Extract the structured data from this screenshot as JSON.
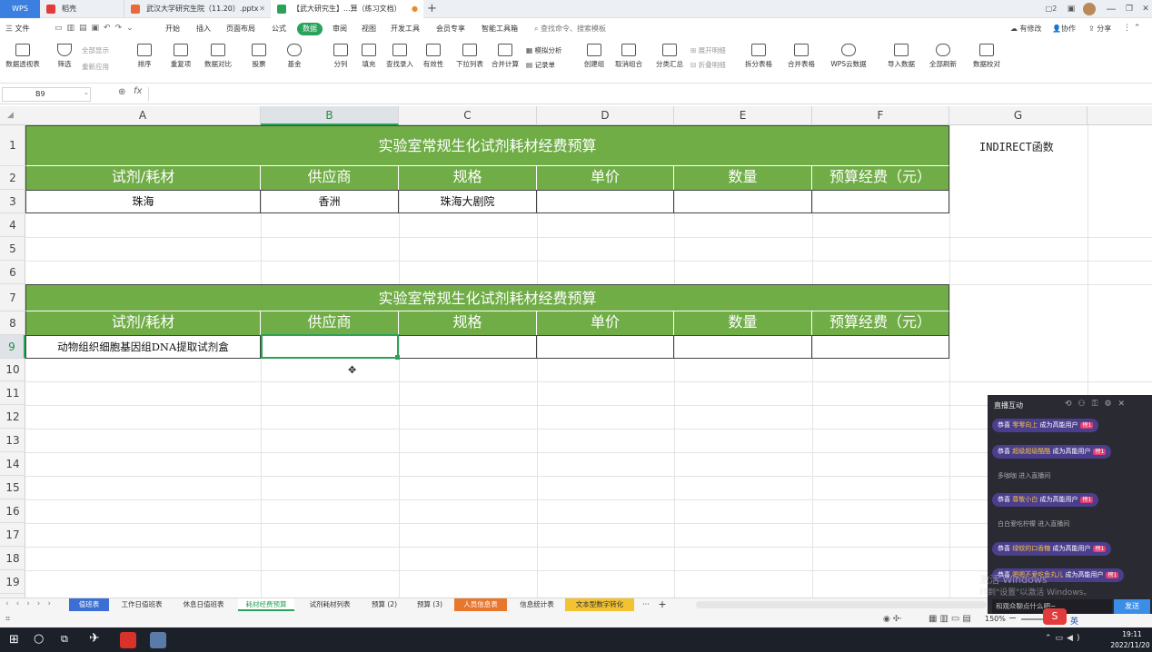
{
  "titlebar": {
    "app_logo": "WPS",
    "tabs": [
      {
        "label": "稻壳",
        "color": "#e33b3b"
      },
      {
        "label": "武汉大学研究生院（11.20）.pptx",
        "color": "#e8693a"
      },
      {
        "label": "【武大研究生】...算（练习文档）",
        "color": "#2aa259"
      }
    ],
    "new_tab": "+",
    "user_icons": [
      "□2",
      "▣",
      "👤"
    ],
    "window": [
      "—",
      "❐",
      "✕"
    ]
  },
  "menubar": {
    "file": "三 文件",
    "items": [
      "开始",
      "插入",
      "页面布局",
      "公式",
      "数据",
      "审阅",
      "视图",
      "开发工具",
      "会员专享",
      "智能工具箱"
    ],
    "active": "数据",
    "search": "查找命令、搜索模板",
    "right": [
      "有修改",
      "协作",
      "分享"
    ]
  },
  "toolbar": {
    "pivot": "数据透视表",
    "filter": "筛选",
    "show_all": "全部显示",
    "reapply": "重新应用",
    "sort": "排序",
    "dup": "重复项",
    "compare": "数据对比",
    "stock": "股票",
    "fund": "基金",
    "split": "分列",
    "fill": "填充",
    "lookup": "查找录入",
    "validity": "有效性",
    "dropdown": "下拉列表",
    "merge_calc": "合并计算",
    "simulate": "模拟分析",
    "record": "记录单",
    "create_group": "创建组",
    "ungroup": "取消组合",
    "subtotal": "分类汇总",
    "expand": "展开明细",
    "collapse": "折叠明细",
    "split_table": "拆分表格",
    "merge_table": "合并表格",
    "wps_cloud": "WPS云数据",
    "import": "导入数据",
    "refresh": "全部刷新",
    "verify": "数据校对"
  },
  "formula": {
    "cell_ref": "B9",
    "fx": "fx",
    "value": ""
  },
  "columns": [
    "A",
    "B",
    "C",
    "D",
    "E",
    "F",
    "G"
  ],
  "rows": [
    "1",
    "2",
    "3",
    "4",
    "5",
    "6",
    "7",
    "8",
    "9",
    "10",
    "11",
    "12",
    "13",
    "14",
    "15",
    "16",
    "17",
    "18",
    "19"
  ],
  "selected_column": "B",
  "selected_row": "9",
  "sheet": {
    "title": "实验室常规生化试剂耗材经费预算",
    "headers": [
      "试剂/耗材",
      "供应商",
      "规格",
      "单价",
      "数量",
      "预算经费（元）"
    ],
    "row3": [
      "珠海",
      "香洲",
      "珠海大剧院",
      "",
      "",
      ""
    ],
    "title2": "实验室常规生化试剂耗材经费预算",
    "headers2": [
      "试剂/耗材",
      "供应商",
      "规格",
      "单价",
      "数量",
      "预算经费（元）"
    ],
    "row9": [
      "动物组织细胞基因组DNA提取试剂盒",
      "",
      "",
      "",
      "",
      ""
    ],
    "g1": "INDIRECT函数"
  },
  "sheet_tabs": [
    {
      "label": "值班表",
      "bg": "#3b6fd4",
      "fg": "#ffffff"
    },
    {
      "label": "工作日值班表",
      "bg": "",
      "fg": "#333333"
    },
    {
      "label": "休息日值班表",
      "bg": "",
      "fg": "#333333"
    },
    {
      "label": "耗材经费预算",
      "bg": "#ffffff",
      "fg": "#2aa259"
    },
    {
      "label": "试剂耗材列表",
      "bg": "",
      "fg": "#333333"
    },
    {
      "label": "预算 (2)",
      "bg": "",
      "fg": "#333333"
    },
    {
      "label": "预算 (3)",
      "bg": "",
      "fg": "#333333"
    },
    {
      "label": "人员信息表",
      "bg": "#e8772e",
      "fg": "#ffffff"
    },
    {
      "label": "信息统计表",
      "bg": "",
      "fg": "#333333"
    },
    {
      "label": "文本型数字转化",
      "bg": "#f2c230",
      "fg": "#333333"
    }
  ],
  "sheet_more": "···",
  "sheet_add": "+",
  "status": {
    "zoom": "150%",
    "minus": "−",
    "plus": "+"
  },
  "live": {
    "title": "直播互动",
    "messages": [
      {
        "kind": "pill",
        "pre": "恭喜",
        "name": "零零向上",
        "post": "成为高能用户",
        "badge": "榜1"
      },
      {
        "kind": "pill",
        "pre": "恭喜",
        "name": "超级超级酷酷",
        "post": "成为高能用户",
        "badge": "榜1"
      },
      {
        "kind": "plain",
        "pre": "",
        "name": "多咖咖",
        "post": "进入直播间",
        "badge": ""
      },
      {
        "kind": "pill",
        "pre": "恭喜",
        "name": "尊敬小白",
        "post": "成为高能用户",
        "badge": "榜1"
      },
      {
        "kind": "plain",
        "pre": "",
        "name": "白白爱吃柠檬",
        "post": "进入直播间",
        "badge": ""
      },
      {
        "kind": "pill",
        "pre": "恭喜",
        "name": "绿蚊的口香糖",
        "post": "成为高能用户",
        "badge": "榜1"
      },
      {
        "kind": "pill",
        "pre": "恭喜",
        "name": "嗯嗯不爱吃鱼丸儿",
        "post": "成为高能用户",
        "badge": "榜1"
      }
    ],
    "input_placeholder": "和观众聊点什么吧~",
    "send": "发送",
    "watermark1": "激活 Windows",
    "watermark2": "转到\"设置\"以激活 Windows。"
  },
  "taskbar": {
    "time": "19:11",
    "date": "2022/11/20",
    "ime": "英"
  }
}
